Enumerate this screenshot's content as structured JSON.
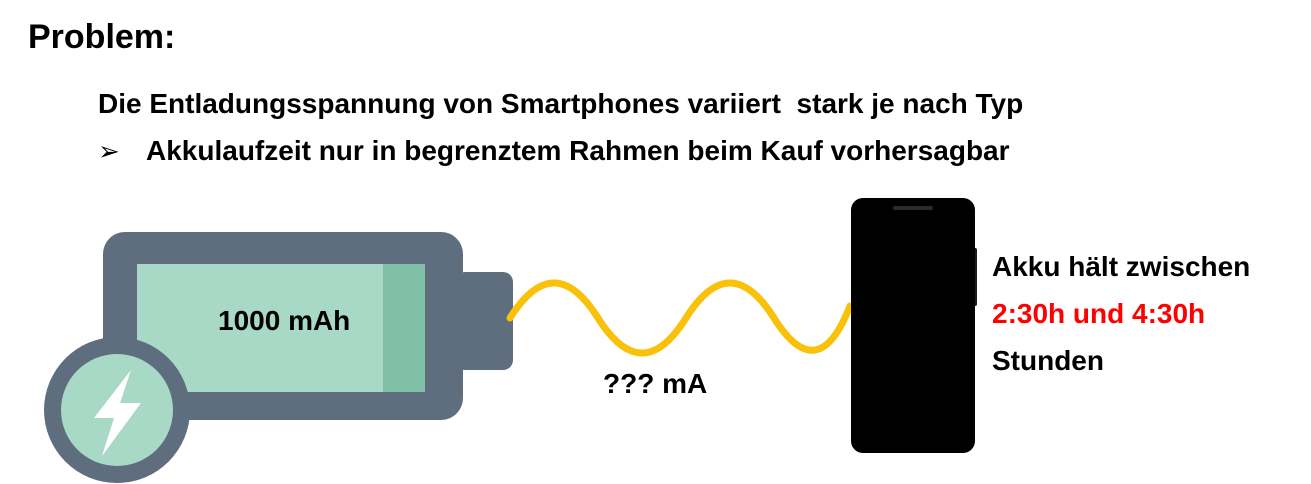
{
  "title": "Problem:",
  "statement": "Die Entladungsspannung von Smartphones variiert  stark je nach Typ",
  "conclusion_bullet": "➢",
  "conclusion": "Akkulaufzeit nur in begrenztem Rahmen beim Kauf vorhersagbar",
  "battery": {
    "capacity_label": "1000 mAh"
  },
  "current_label": "??? mA",
  "runtime": {
    "line1": "Akku hält zwischen",
    "line2": "2:30h und 4:30h",
    "line3": "Stunden"
  },
  "colors": {
    "battery_body": "#5f6e7f",
    "battery_fill": "#a8d9c6",
    "battery_fill_end": "#80c0a7",
    "charge_circle": "#a8d9c6",
    "wire": "#f9c10a",
    "phone": "#000000",
    "highlight": "#ff0000"
  }
}
